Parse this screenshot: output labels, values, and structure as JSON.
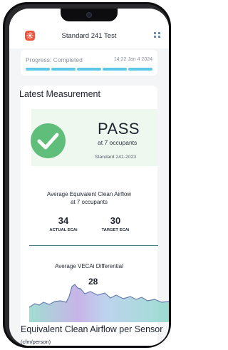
{
  "header": {
    "title": "Standard 241 Test",
    "app_icon": "sun-icon",
    "menu_icon": "grid-icon"
  },
  "progress": {
    "label": "Progress: Completed",
    "timestamp": "14:22 Jan 4 2024",
    "segments": 5,
    "fraction": 1.0,
    "color": "#5cc8e8"
  },
  "latest": {
    "title": "Latest Measurement",
    "status": "PASS",
    "occupants_text": "at 7 occupants",
    "standard": "Standard 241-2023",
    "status_color": "#5fbe7a"
  },
  "airflow": {
    "title_line1": "Average Equivalent Clean Airflow",
    "title_line2": "at 7 occupants",
    "actual_value": "34",
    "actual_label": "ACTUAL ECAi",
    "target_value": "30",
    "target_label": "TARGET ECAi"
  },
  "differential": {
    "title": "Average VECAi Differential",
    "value": "28"
  },
  "sensor_section": {
    "title": "Equivalent Clean Airflow per Sensor",
    "unit": "(cfm/person)"
  }
}
